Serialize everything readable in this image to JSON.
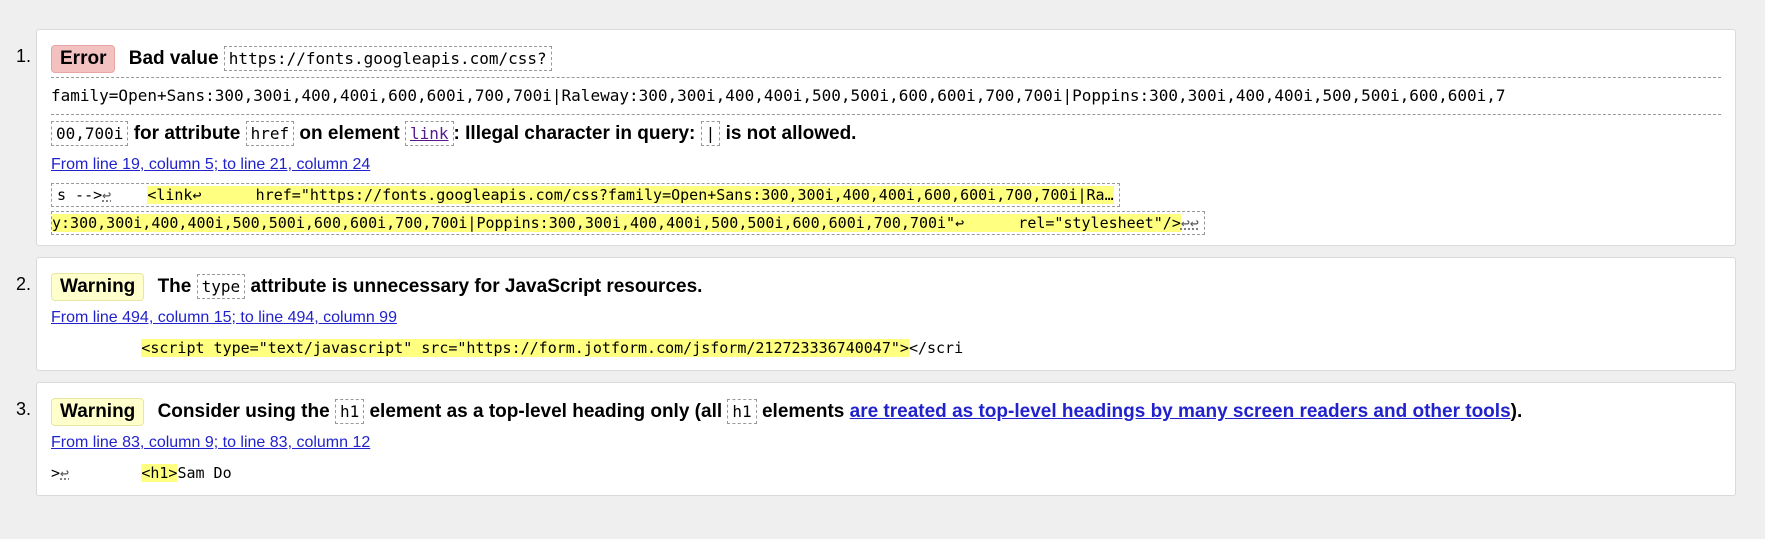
{
  "messages": [
    {
      "number": "1.",
      "type_label": "Error",
      "parts": {
        "bad_value": "Bad value",
        "value_line1": "https://fonts.googleapis.com/css?",
        "value_line2": "family=Open+Sans:300,300i,400,400i,600,600i,700,700i|Raleway:300,300i,400,400i,500,500i,600,600i,700,700i|Poppins:300,300i,400,400i,500,500i,600,600i,7",
        "value_line3": "00,700i",
        "for_attribute": "for attribute",
        "attr": "href",
        "on_element": "on element",
        "element": "link",
        "colon_text": ": Illegal character in query:",
        "char": "|",
        "not_allowed": "is not allowed."
      },
      "location": "From line 19, column 5; to line 21, column 24",
      "extract": {
        "before": "s -->",
        "ret": "↩",
        "gap": "    ",
        "highlight_line1": "<link↩      href=\"https://fonts.googleapis.com/css?family=Open+Sans:300,300i,400,400i,600,600i,700,700i|Ra…",
        "highlight_line2": "y:300,300i,400,400i,500,500i,600,600i,700,700i|Poppins:300,300i,400,400i,500,500i,600,600i,700,700i\"↩      rel=\"stylesheet\"/>",
        "after": "↩↩"
      }
    },
    {
      "number": "2.",
      "type_label": "Warning",
      "parts": {
        "the": "The",
        "attr": "type",
        "rest": "attribute is unnecessary for JavaScript resources."
      },
      "location": "From line 494, column 15; to line 494, column 99",
      "extract": {
        "before": "          ",
        "highlight": "<script type=\"text/javascript\" src=\"https://form.jotform.com/jsform/212723336740047\">",
        "after": "</scri"
      }
    },
    {
      "number": "3.",
      "type_label": "Warning",
      "parts": {
        "consider": "Consider using the",
        "el1": "h1",
        "middle": "element as a top-level heading only (all",
        "el2": "h1",
        "elements": "elements",
        "link": "are treated as top-level headings by many screen readers and other tools",
        "end": ")."
      },
      "location": "From line 83, column 9; to line 83, column 12",
      "extract": {
        "before": ">",
        "ret": "↩",
        "gap": "        ",
        "highlight": "<h1>",
        "after": "Sam Do"
      }
    }
  ]
}
